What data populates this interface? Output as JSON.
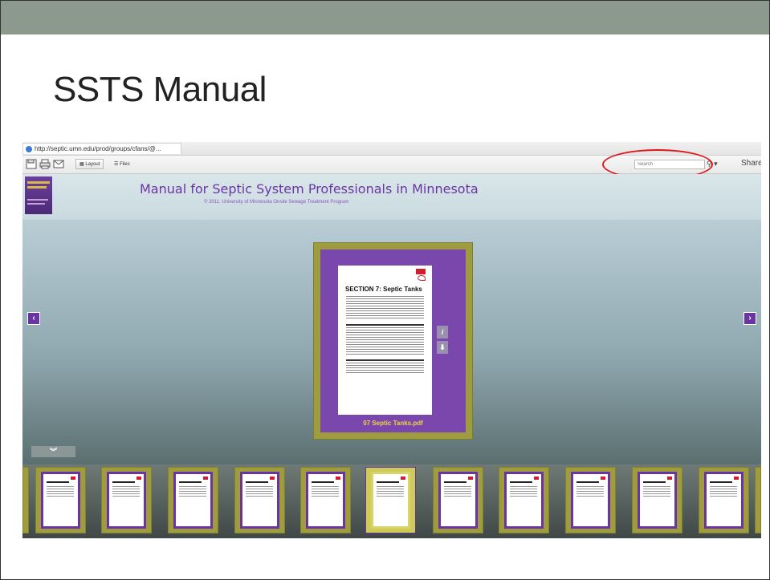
{
  "slide": {
    "title": "SSTS Manual"
  },
  "browser": {
    "url_tab": "http://septic.umn.edu/prod/groups/cfans/@..."
  },
  "toolbar": {
    "layout_label": "Layout",
    "files_label": "Files",
    "search_placeholder": "Search",
    "share_label": "Share"
  },
  "header": {
    "title": "Manual for Septic System Professionals in Minnesota",
    "copyright": "© 2011. University of Minnesota Onsite Sewage Treatment Program"
  },
  "viewer": {
    "page_heading": "SECTION 7: Septic Tanks",
    "caption": "07 Septic Tanks.pdf",
    "prev_icon": "‹",
    "next_icon": "›",
    "info_icon": "i",
    "download_icon": "⬇",
    "collapse_icon": "︾"
  },
  "thumbnails": {
    "count": 11,
    "active_index": 5
  },
  "colors": {
    "accent": "#6a35a2",
    "frame": "#9e9c3e",
    "highlight": "#e0161b"
  }
}
